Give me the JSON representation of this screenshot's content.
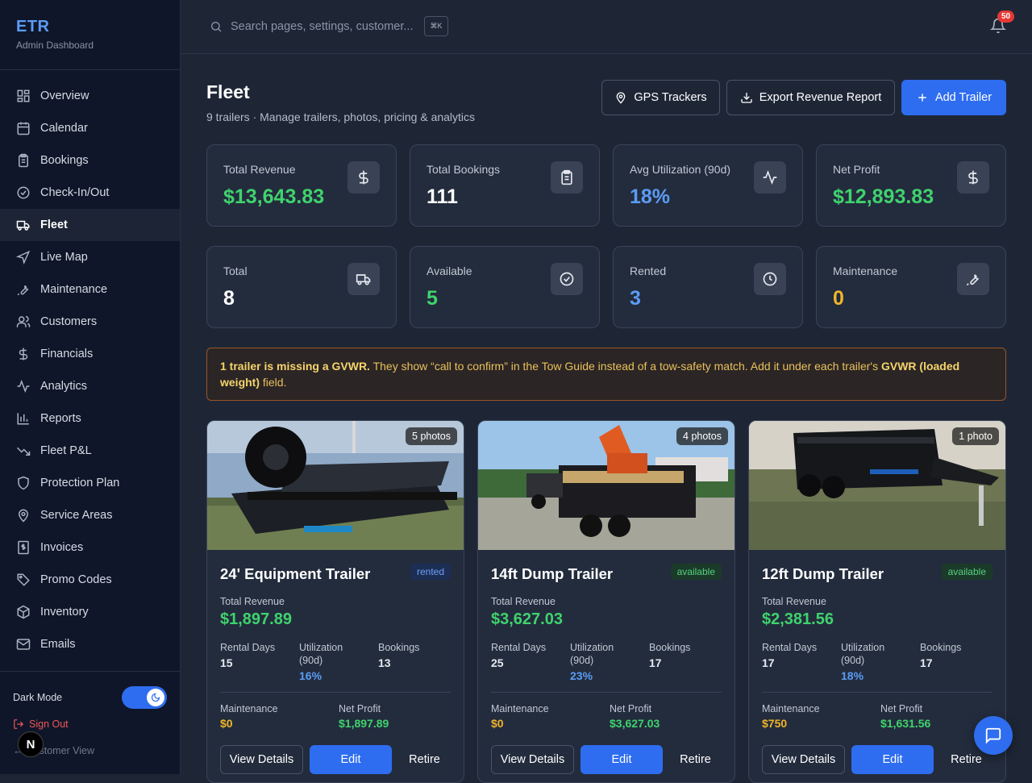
{
  "brand": {
    "title": "ETR",
    "subtitle": "Admin Dashboard"
  },
  "nav": [
    {
      "label": "Overview",
      "icon": "grid-icon"
    },
    {
      "label": "Calendar",
      "icon": "calendar-icon"
    },
    {
      "label": "Bookings",
      "icon": "clipboard-icon"
    },
    {
      "label": "Check-In/Out",
      "icon": "check-circle-icon"
    },
    {
      "label": "Fleet",
      "icon": "truck-icon",
      "active": true
    },
    {
      "label": "Live Map",
      "icon": "navigation-icon"
    },
    {
      "label": "Maintenance",
      "icon": "wrench-icon"
    },
    {
      "label": "Customers",
      "icon": "users-icon"
    },
    {
      "label": "Financials",
      "icon": "dollar-icon"
    },
    {
      "label": "Analytics",
      "icon": "activity-icon"
    },
    {
      "label": "Reports",
      "icon": "bar-chart-icon"
    },
    {
      "label": "Fleet P&L",
      "icon": "trending-down-icon"
    },
    {
      "label": "Protection Plan",
      "icon": "shield-icon"
    },
    {
      "label": "Service Areas",
      "icon": "map-pin-icon"
    },
    {
      "label": "Invoices",
      "icon": "receipt-icon"
    },
    {
      "label": "Promo Codes",
      "icon": "tag-icon"
    },
    {
      "label": "Inventory",
      "icon": "package-icon"
    },
    {
      "label": "Emails",
      "icon": "mail-icon"
    }
  ],
  "sidebar_bottom": {
    "dark_mode": "Dark Mode",
    "sign_out": "Sign Out",
    "customer_view": "Customer View",
    "avatar": "N"
  },
  "topbar": {
    "search_placeholder": "Search pages, settings, customer...",
    "shortcut": "⌘K",
    "notifications": "50"
  },
  "header": {
    "title": "Fleet",
    "subtitle": "9 trailers · Manage trailers, photos, pricing & analytics",
    "gps_button": "GPS Trackers",
    "export_button": "Export Revenue Report",
    "add_button": "Add Trailer"
  },
  "stats_row1": [
    {
      "label": "Total Revenue",
      "value": "$13,643.83",
      "color": "#3fd36d",
      "icon": "dollar-icon"
    },
    {
      "label": "Total Bookings",
      "value": "111",
      "color": "#ffffff",
      "icon": "clipboard-icon"
    },
    {
      "label": "Avg Utilization (90d)",
      "value": "18%",
      "color": "#5b9cf5",
      "icon": "activity-icon"
    },
    {
      "label": "Net Profit",
      "value": "$12,893.83",
      "color": "#3fd36d",
      "icon": "dollar-icon"
    }
  ],
  "stats_row2": [
    {
      "label": "Total",
      "value": "8",
      "color": "#ffffff",
      "icon": "truck-icon"
    },
    {
      "label": "Available",
      "value": "5",
      "color": "#3fd36d",
      "icon": "check-circle-icon"
    },
    {
      "label": "Rented",
      "value": "3",
      "color": "#5b9cf5",
      "icon": "clock-icon"
    },
    {
      "label": "Maintenance",
      "value": "0",
      "color": "#f0b429",
      "icon": "wrench-icon"
    }
  ],
  "warning": {
    "bold1": "1 trailer is missing a GVWR.",
    "text1": " They show “call to confirm” in the Tow Guide instead of a tow-safety match. Add it under each trailer's ",
    "bold2": "GVWR (loaded weight)",
    "text2": " field."
  },
  "labels": {
    "total_revenue": "Total Revenue",
    "rental_days": "Rental Days",
    "utilization": "Utilization (90d)",
    "bookings": "Bookings",
    "maintenance": "Maintenance",
    "net_profit": "Net Profit",
    "view_details": "View Details",
    "edit": "Edit",
    "retire": "Retire"
  },
  "trailers": [
    {
      "name": "24' Equipment Trailer",
      "status": "rented",
      "photos": "5 photos",
      "revenue": "$1,897.89",
      "rental_days": "15",
      "utilization": "16%",
      "bookings": "13",
      "maintenance": "$0",
      "net_profit": "$1,897.89"
    },
    {
      "name": "14ft Dump Trailer",
      "status": "available",
      "photos": "4 photos",
      "revenue": "$3,627.03",
      "rental_days": "25",
      "utilization": "23%",
      "bookings": "17",
      "maintenance": "$0",
      "net_profit": "$3,627.03"
    },
    {
      "name": "12ft Dump Trailer",
      "status": "available",
      "photos": "1 photo",
      "revenue": "$2,381.56",
      "rental_days": "17",
      "utilization": "18%",
      "bookings": "17",
      "maintenance": "$750",
      "net_profit": "$1,631.56"
    }
  ],
  "colors": {
    "accent": "#2e6df0",
    "green": "#3fd36d",
    "blue": "#5b9cf5",
    "amber": "#f0b429",
    "sidebar_bg": "#0f1629",
    "page_bg": "#1e2636"
  }
}
